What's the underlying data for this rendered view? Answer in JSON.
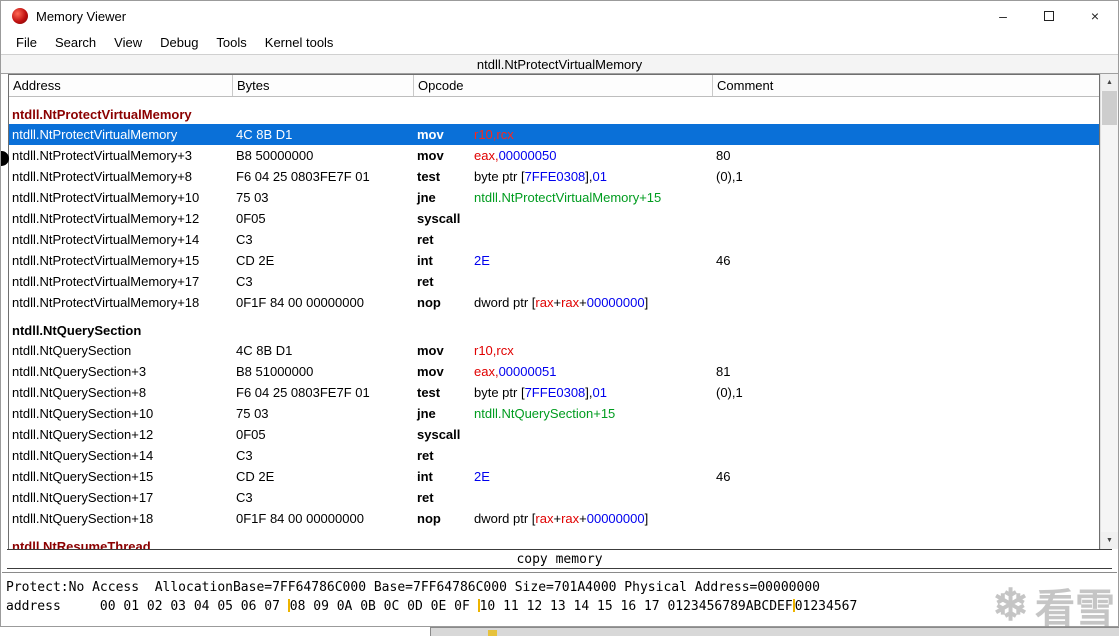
{
  "window": {
    "title": "Memory Viewer"
  },
  "titlebar_controls": {
    "minimize": "–",
    "close": "×"
  },
  "menu": {
    "items": [
      "File",
      "Search",
      "View",
      "Debug",
      "Tools",
      "Kernel tools"
    ]
  },
  "symbol_header": "ntdll.NtProtectVirtualMemory",
  "columns": [
    "Address",
    "Bytes",
    "Opcode",
    "Comment"
  ],
  "scrollbar": {
    "up": "▲",
    "down": "▼"
  },
  "disasm": {
    "rows": [
      {
        "type": "section",
        "label": "ntdll.NtProtectVirtualMemory",
        "accent": "maroon"
      },
      {
        "type": "instr",
        "selected": true,
        "address": "ntdll.NtProtectVirtualMemory",
        "bytes": "4C 8B D1",
        "mnemonic": "mov",
        "operands": [
          [
            "r10,rcx",
            "r"
          ]
        ],
        "comment": ""
      },
      {
        "type": "instr",
        "address": "ntdll.NtProtectVirtualMemory+3",
        "bytes": "B8 50000000",
        "mnemonic": "mov",
        "operands": [
          [
            "eax,",
            "r"
          ],
          [
            "00000050",
            "b"
          ]
        ],
        "comment": "80"
      },
      {
        "type": "instr",
        "address": "ntdll.NtProtectVirtualMemory+8",
        "bytes": "F6 04 25 0803FE7F 01",
        "mnemonic": "test",
        "operands": [
          [
            "byte ptr [",
            ""
          ],
          [
            "7FFE0308",
            "b"
          ],
          [
            "],",
            ""
          ],
          [
            "01",
            "b"
          ]
        ],
        "comment": "(0),1"
      },
      {
        "type": "instr",
        "address": "ntdll.NtProtectVirtualMemory+10",
        "bytes": "75 03",
        "mnemonic": "jne",
        "operands": [
          [
            "ntdll.NtProtectVirtualMemory+15",
            "g"
          ]
        ],
        "comment": ""
      },
      {
        "type": "instr",
        "address": "ntdll.NtProtectVirtualMemory+12",
        "bytes": "0F05",
        "mnemonic": "syscall",
        "operands": [],
        "comment": ""
      },
      {
        "type": "instr",
        "address": "ntdll.NtProtectVirtualMemory+14",
        "bytes": "C3",
        "mnemonic": "ret",
        "operands": [],
        "comment": ""
      },
      {
        "type": "instr",
        "address": "ntdll.NtProtectVirtualMemory+15",
        "bytes": "CD 2E",
        "mnemonic": "int",
        "operands": [
          [
            "2E",
            "b"
          ]
        ],
        "comment": "46",
        "arrow": true
      },
      {
        "type": "instr",
        "address": "ntdll.NtProtectVirtualMemory+17",
        "bytes": "C3",
        "mnemonic": "ret",
        "operands": [],
        "comment": ""
      },
      {
        "type": "instr",
        "address": "ntdll.NtProtectVirtualMemory+18",
        "bytes": "0F1F 84 00 00000000",
        "mnemonic": "nop",
        "operands": [
          [
            "dword ptr [",
            ""
          ],
          [
            "rax",
            "r"
          ],
          [
            "+",
            ""
          ],
          [
            "rax",
            "r"
          ],
          [
            "+",
            ""
          ],
          [
            "00000000",
            "b"
          ],
          [
            "]",
            ""
          ]
        ],
        "comment": ""
      },
      {
        "type": "section",
        "label": "ntdll.NtQuerySection",
        "accent": "black"
      },
      {
        "type": "instr",
        "address": "ntdll.NtQuerySection",
        "bytes": "4C 8B D1",
        "mnemonic": "mov",
        "operands": [
          [
            "r10,rcx",
            "r"
          ]
        ],
        "comment": ""
      },
      {
        "type": "instr",
        "address": "ntdll.NtQuerySection+3",
        "bytes": "B8 51000000",
        "mnemonic": "mov",
        "operands": [
          [
            "eax,",
            "r"
          ],
          [
            "00000051",
            "b"
          ]
        ],
        "comment": "81"
      },
      {
        "type": "instr",
        "address": "ntdll.NtQuerySection+8",
        "bytes": "F6 04 25 0803FE7F 01",
        "mnemonic": "test",
        "operands": [
          [
            "byte ptr [",
            ""
          ],
          [
            "7FFE0308",
            "b"
          ],
          [
            "],",
            ""
          ],
          [
            "01",
            "b"
          ]
        ],
        "comment": "(0),1"
      },
      {
        "type": "instr",
        "address": "ntdll.NtQuerySection+10",
        "bytes": "75 03",
        "mnemonic": "jne",
        "operands": [
          [
            "ntdll.NtQuerySection+15",
            "g"
          ]
        ],
        "comment": ""
      },
      {
        "type": "instr",
        "address": "ntdll.NtQuerySection+12",
        "bytes": "0F05",
        "mnemonic": "syscall",
        "operands": [],
        "comment": ""
      },
      {
        "type": "instr",
        "address": "ntdll.NtQuerySection+14",
        "bytes": "C3",
        "mnemonic": "ret",
        "operands": [],
        "comment": ""
      },
      {
        "type": "instr",
        "address": "ntdll.NtQuerySection+15",
        "bytes": "CD 2E",
        "mnemonic": "int",
        "operands": [
          [
            "2E",
            "b"
          ]
        ],
        "comment": "46",
        "arrow": true
      },
      {
        "type": "instr",
        "address": "ntdll.NtQuerySection+17",
        "bytes": "C3",
        "mnemonic": "ret",
        "operands": [],
        "comment": ""
      },
      {
        "type": "instr",
        "address": "ntdll.NtQuerySection+18",
        "bytes": "0F1F 84 00 00000000",
        "mnemonic": "nop",
        "operands": [
          [
            "dword ptr [",
            ""
          ],
          [
            "rax",
            "r"
          ],
          [
            "+",
            ""
          ],
          [
            "rax",
            "r"
          ],
          [
            "+",
            ""
          ],
          [
            "00000000",
            "b"
          ],
          [
            "]",
            ""
          ]
        ],
        "comment": ""
      },
      {
        "type": "section",
        "label": "ntdll.NtResumeThread",
        "accent": "maroon"
      }
    ]
  },
  "copy_memory": {
    "label": "copy memory"
  },
  "hexview": {
    "info_line": "Protect:No Access  AllocationBase=7FF64786C000 Base=7FF64786C000 Size=701A4000 Physical Address=00000000",
    "address_segments": [
      "address     00 01 02 03 04 05 06 07 ",
      "08 09 0A 0B 0C 0D 0E 0F ",
      "10 11 12 13 14 15 16 17 0123456789ABCDEF",
      "01234567"
    ]
  },
  "watermark": {
    "text": "看雪"
  }
}
